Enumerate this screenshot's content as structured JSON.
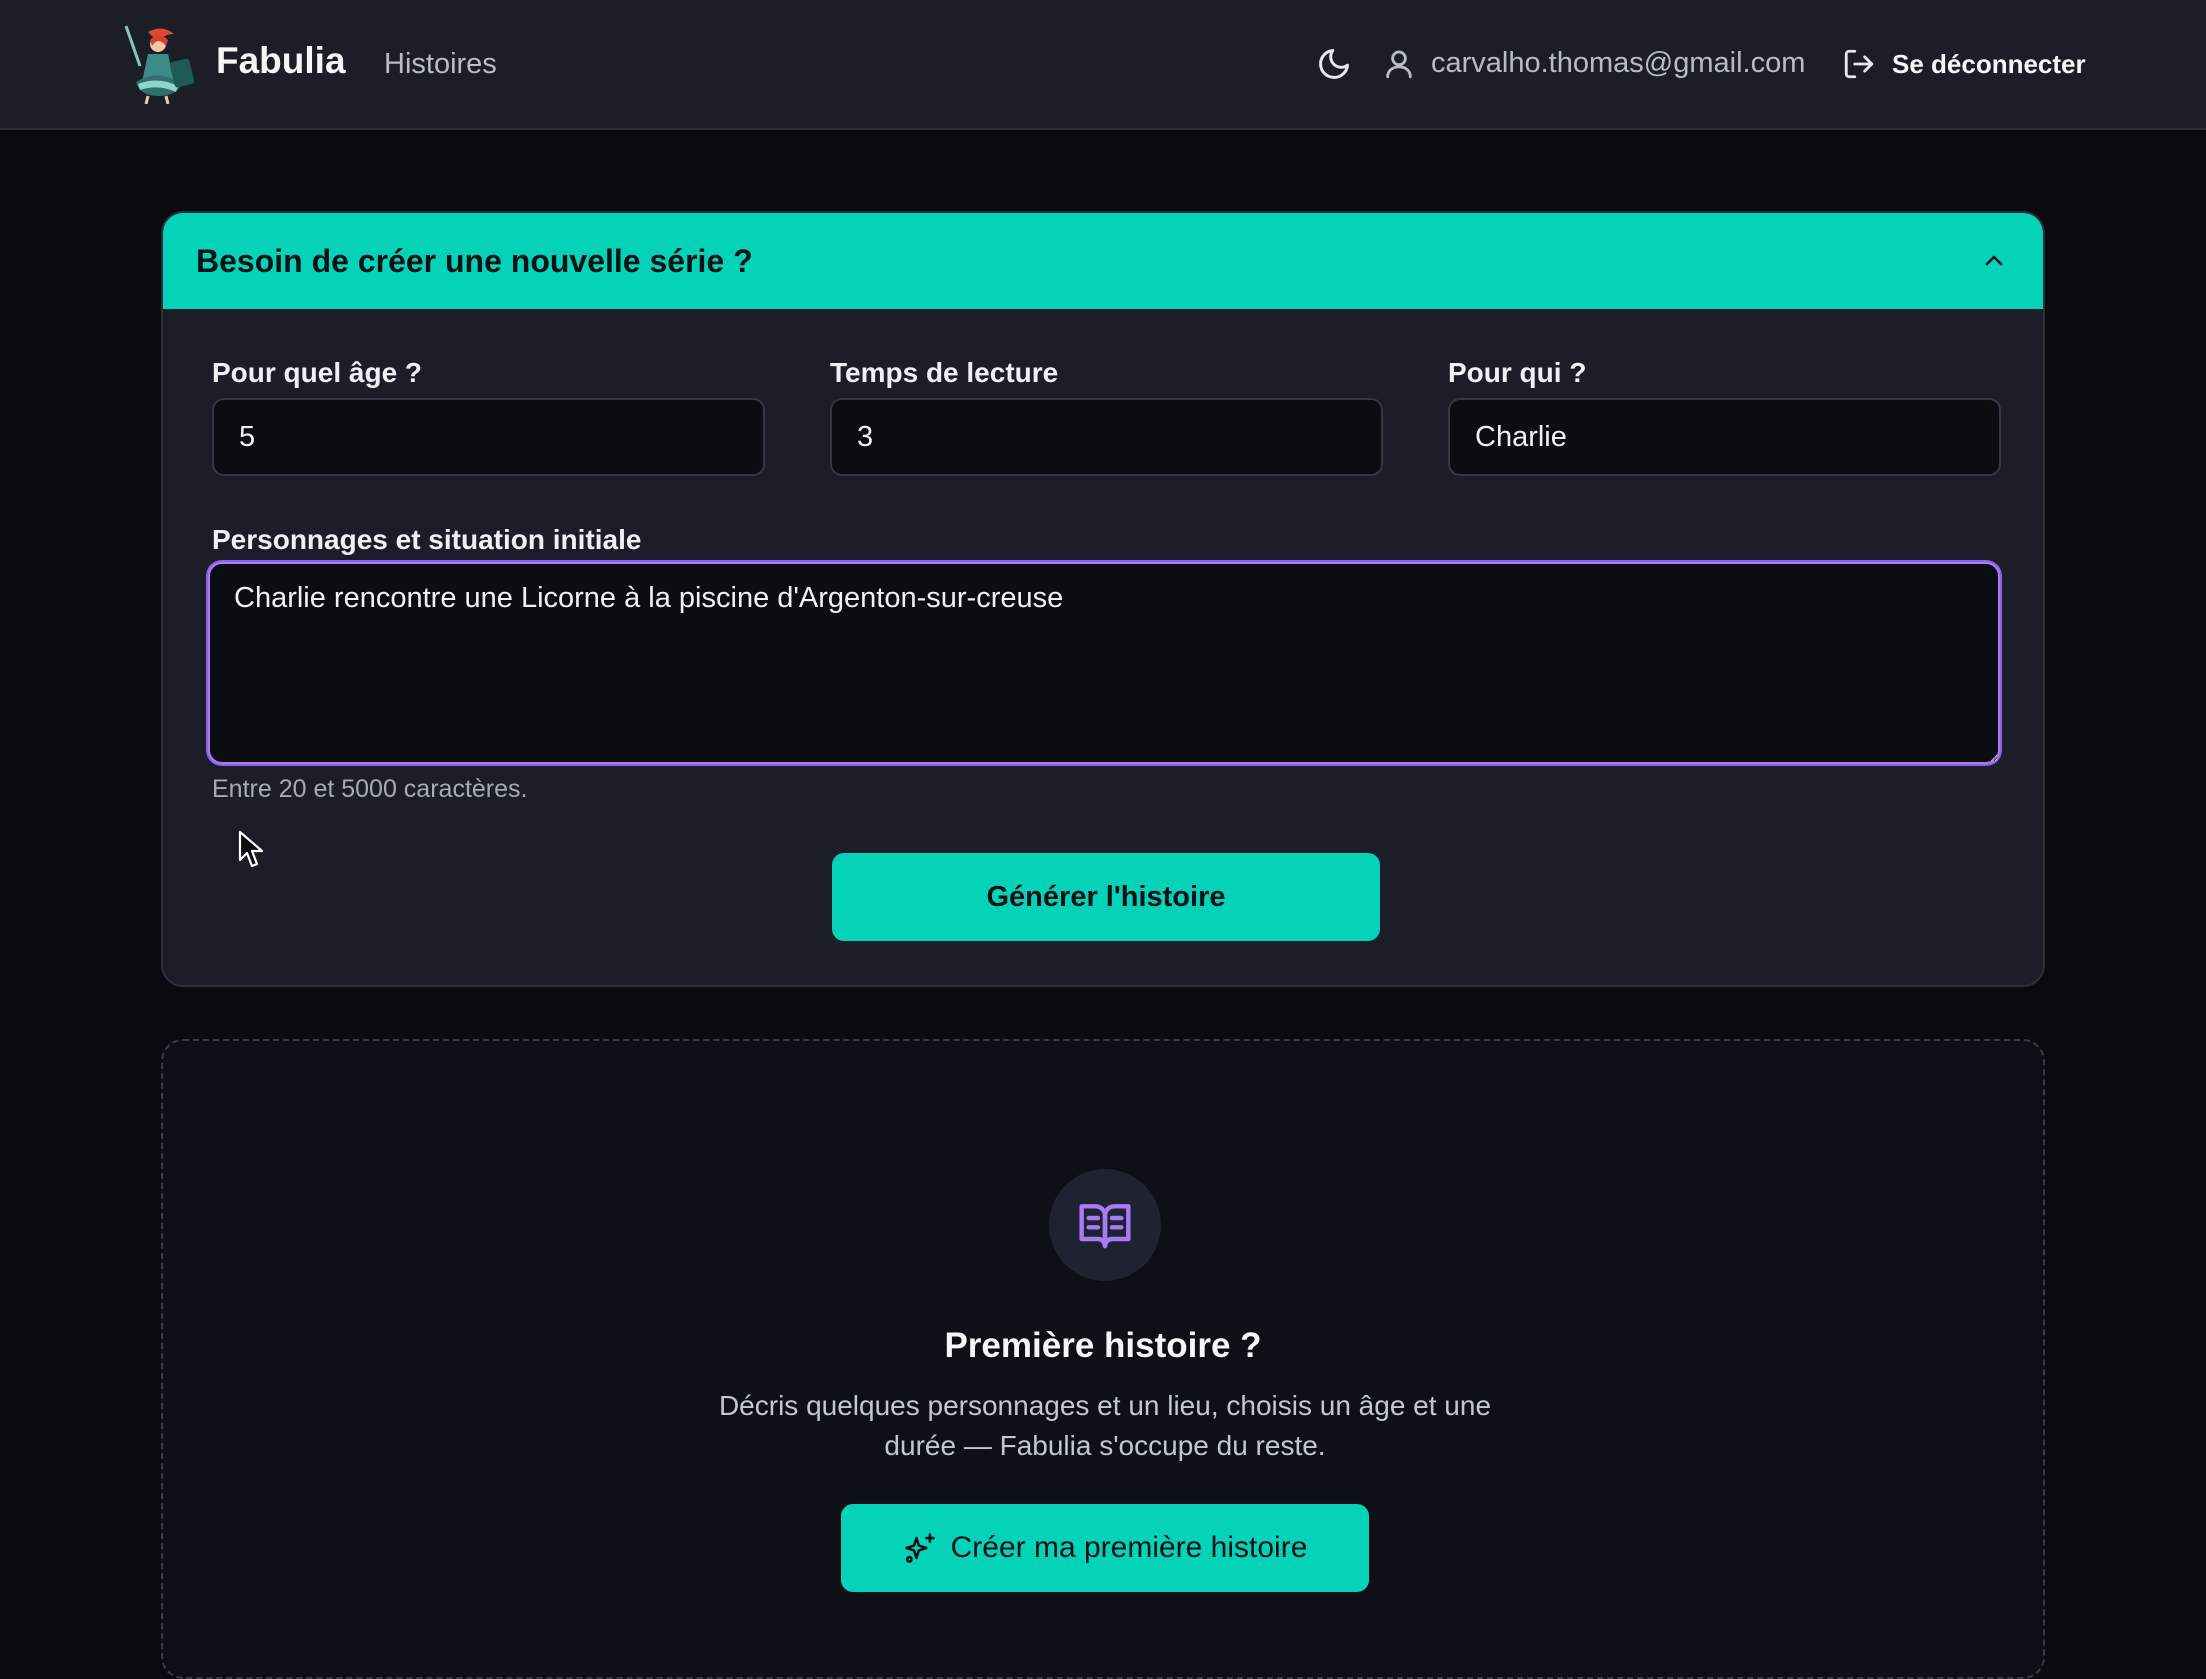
{
  "header": {
    "brand": "Fabulia",
    "nav_stories": "Histoires",
    "theme_icon": "moon-icon",
    "user_icon": "user-icon",
    "email": "carvalho.thomas@gmail.com",
    "logout_label": "Se déconnecter",
    "logout_icon": "logout-icon"
  },
  "panel": {
    "title": "Besoin de créer une nouvelle série ?",
    "collapse_icon": "chevron-up-icon",
    "fields": {
      "age": {
        "label": "Pour quel âge ?",
        "value": "5"
      },
      "reading_time": {
        "label": "Temps de lecture",
        "value": "3"
      },
      "for_whom": {
        "label": "Pour qui ?",
        "value": "Charlie"
      }
    },
    "situation": {
      "label": "Personnages et situation initiale",
      "value": "Charlie rencontre une Licorne à la piscine d'Argenton-sur-creuse",
      "hint": "Entre 20 et 5000 caractères."
    },
    "generate_label": "Générer l'histoire"
  },
  "empty_state": {
    "icon": "open-book-icon",
    "title": "Première histoire ?",
    "description": "Décris quelques personnages et un lieu, choisis un âge et une durée — Fabulia s'occupe du reste.",
    "cta_label": "Créer ma première histoire",
    "cta_icon": "sparkles-icon"
  },
  "colors": {
    "accent": "#04d3b7",
    "focus": "#a67cf5",
    "background": "#090b10",
    "header_bg": "#1b1e27"
  }
}
